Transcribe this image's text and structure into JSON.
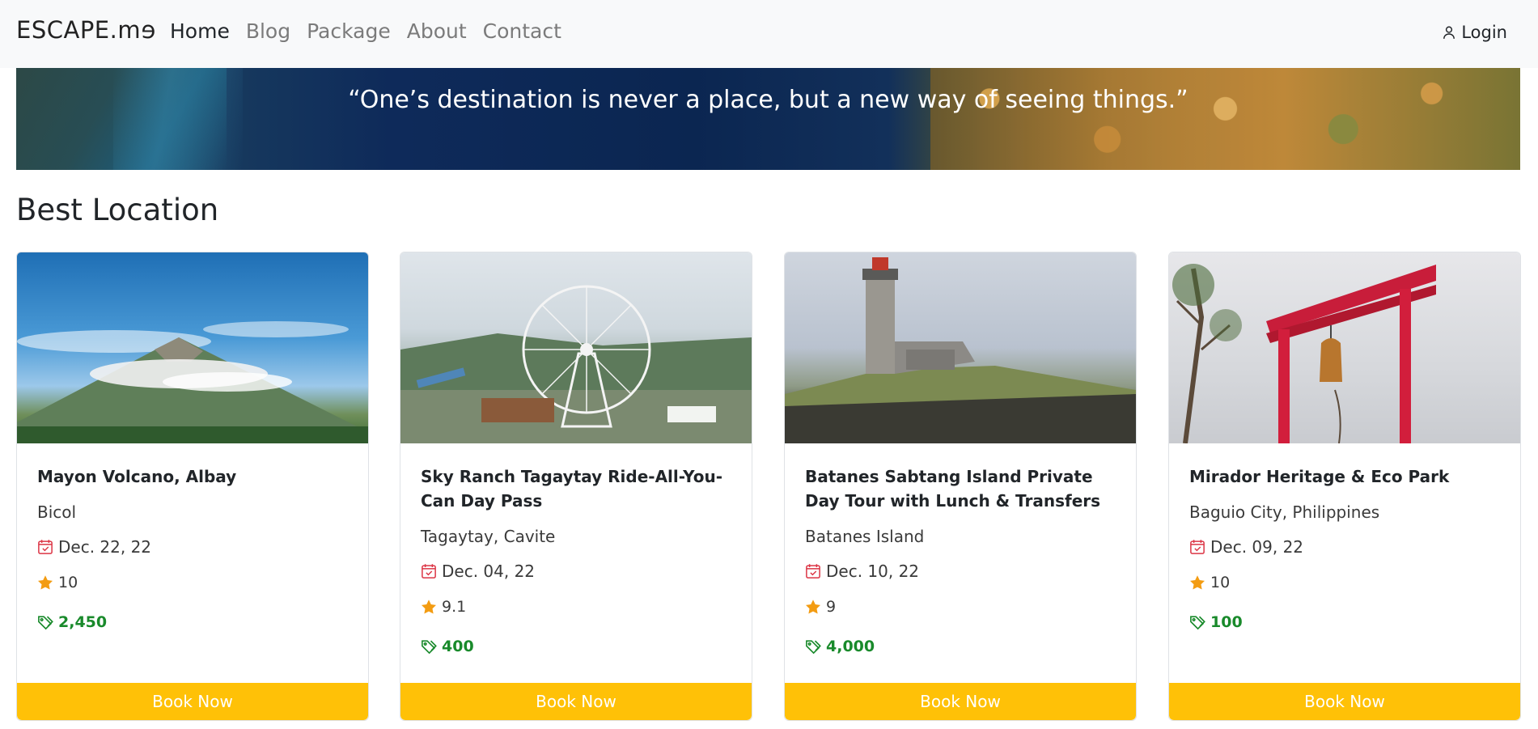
{
  "navbar": {
    "brand_main": "ESCAPE.m",
    "brand_tail": "e",
    "links": [
      "Home",
      "Blog",
      "Package",
      "About",
      "Contact"
    ],
    "login_label": "Login"
  },
  "hero": {
    "quote": "“One’s destination is never a place, but a new way of seeing things.”"
  },
  "section": {
    "title": "Best Location"
  },
  "cards": [
    {
      "title": "Mayon Volcano, Albay",
      "location": "Bicol",
      "date": "Dec. 22, 22",
      "rating": "10",
      "price": "2,450",
      "button": "Book Now"
    },
    {
      "title": "Sky Ranch Tagaytay Ride-All-You-Can Day Pass",
      "location": "Tagaytay, Cavite",
      "date": "Dec. 04, 22",
      "rating": "9.1",
      "price": "400",
      "button": "Book Now"
    },
    {
      "title": "Batanes Sabtang Island Private Day Tour with Lunch & Transfers",
      "location": "Batanes Island",
      "date": "Dec. 10, 22",
      "rating": "9",
      "price": "4,000",
      "button": "Book Now"
    },
    {
      "title": "Mirador Heritage & Eco Park",
      "location": "Baguio City, Philippines",
      "date": "Dec. 09, 22",
      "rating": "10",
      "price": "100",
      "button": "Book Now"
    }
  ],
  "icons": {
    "login": "person-icon",
    "date": "calendar-icon",
    "rating": "star-icon",
    "price": "price-tag-icon"
  },
  "colors": {
    "accent": "#ffc107",
    "price": "#198a2b",
    "calendar": "#dc3545",
    "star": "#f39c12",
    "navbar_bg": "#f8f9fa"
  }
}
